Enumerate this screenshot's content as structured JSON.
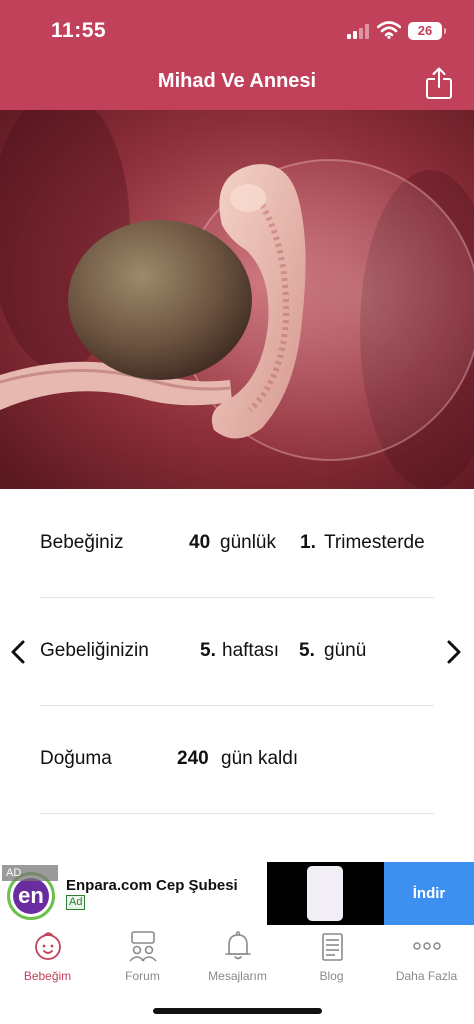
{
  "status_bar": {
    "time": "11:55",
    "battery": "26"
  },
  "header": {
    "title": "Mihad Ve Annesi",
    "share_icon": "share-icon"
  },
  "hero": {
    "image": "embryo-illustration"
  },
  "info": {
    "row1": {
      "label": "Bebeğiniz",
      "days": "40",
      "days_unit": "günlük",
      "trimester": "1.",
      "trimester_label": "Trimesterde"
    },
    "row2": {
      "label": "Gebeliğinizin",
      "week": "5.",
      "week_label": "haftası",
      "day": "5.",
      "day_label": "günü"
    },
    "row3": {
      "label": "Doğuma",
      "remaining": "240",
      "remaining_label": "gün kaldı"
    }
  },
  "ad": {
    "tag": "AD",
    "logo_text": "en",
    "title": "Enpara.com Cep Şubesi",
    "badge": "Ad",
    "cta": "İndir"
  },
  "tabs": [
    {
      "label": "Bebeğim",
      "icon": "baby-icon",
      "active": true
    },
    {
      "label": "Forum",
      "icon": "forum-icon",
      "active": false
    },
    {
      "label": "Mesajlarım",
      "icon": "bell-icon",
      "active": false
    },
    {
      "label": "Blog",
      "icon": "blog-icon",
      "active": false
    },
    {
      "label": "Daha Fazla",
      "icon": "more-icon",
      "active": false
    }
  ],
  "colors": {
    "brand": "#c2415a",
    "ad_cta": "#3d8ff0",
    "tab_inactive": "#8a8a8a"
  }
}
